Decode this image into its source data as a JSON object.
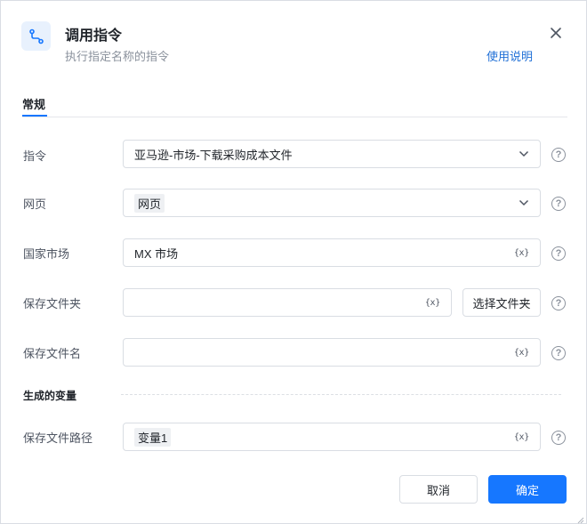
{
  "dialog": {
    "title": "调用指令",
    "subtitle": "执行指定名称的指令",
    "help_link": "使用说明",
    "icon": "branch-icon",
    "close_icon": "close-icon"
  },
  "tabs": [
    {
      "label": "常规",
      "active": true
    }
  ],
  "form": {
    "command": {
      "label": "指令",
      "value": "亚马逊-市场-下载采购成本文件"
    },
    "webpage": {
      "label": "网页",
      "value": "网页"
    },
    "market": {
      "label": "国家市场",
      "value": "MX 市场"
    },
    "save_folder": {
      "label": "保存文件夹",
      "value": "",
      "button": "选择文件夹"
    },
    "save_filename": {
      "label": "保存文件名",
      "value": ""
    }
  },
  "outputs": {
    "section_title": "生成的变量",
    "save_path": {
      "label": "保存文件路径",
      "value": "变量1"
    }
  },
  "var_icon_text": "{x}",
  "help_icon_text": "?",
  "footer": {
    "cancel": "取消",
    "confirm": "确定"
  },
  "colors": {
    "primary": "#1677ff",
    "link": "#1f6fd6"
  }
}
